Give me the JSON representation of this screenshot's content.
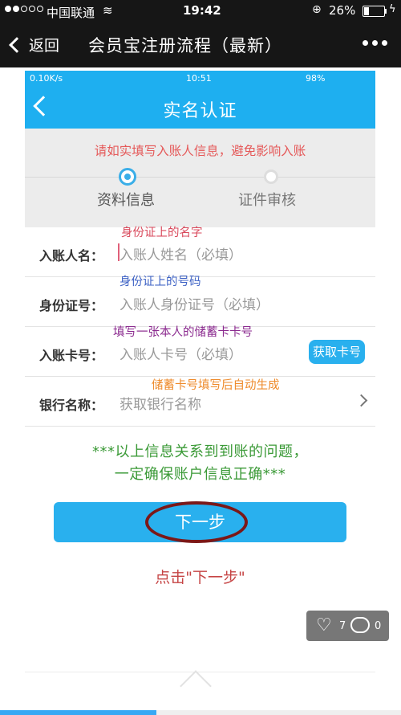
{
  "status_bar": {
    "carrier": "中国联通",
    "time": "19:42",
    "battery": "26%",
    "battery_level": 0.26
  },
  "nav": {
    "back_label": "返回",
    "title": "会员宝注册流程（最新）"
  },
  "inner_status": {
    "left": "0.10K/s",
    "time": "10:51",
    "right": "98%"
  },
  "inner_header": {
    "title": "实名认证"
  },
  "warning": "请如实填写入账人信息，避免影响入账",
  "steps": [
    "资料信息",
    "证件审核"
  ],
  "form": {
    "rows": [
      {
        "label": "入账人名：",
        "placeholder": "入账人姓名（必填）"
      },
      {
        "label": "身份证号：",
        "placeholder": "入账人身份证号（必填）"
      },
      {
        "label": "入账卡号：",
        "placeholder": "入账人卡号（必填）"
      },
      {
        "label": "银行名称：",
        "placeholder": "获取银行名称"
      }
    ],
    "get_card_button": "获取卡号"
  },
  "annotations": {
    "name_note": "身份证上的名字",
    "id_note": "身份证上的号码",
    "card_note": "填写一张本人的储蓄卡卡号",
    "bank_note": "储蓄卡号填写后自动生成"
  },
  "info_lines": [
    "***以上信息关系到到账的问题，",
    "一定确保账户信息正确***"
  ],
  "next_button": "下一步",
  "click_note": "点击\"下一步\"",
  "social": {
    "likes": "7",
    "comments": "0"
  },
  "reading_progress": 0.39,
  "colors": {
    "accent": "#1eaff0",
    "warning": "#e55a5a",
    "info": "#3b9a37",
    "highlight_circle": "#7b1818"
  }
}
